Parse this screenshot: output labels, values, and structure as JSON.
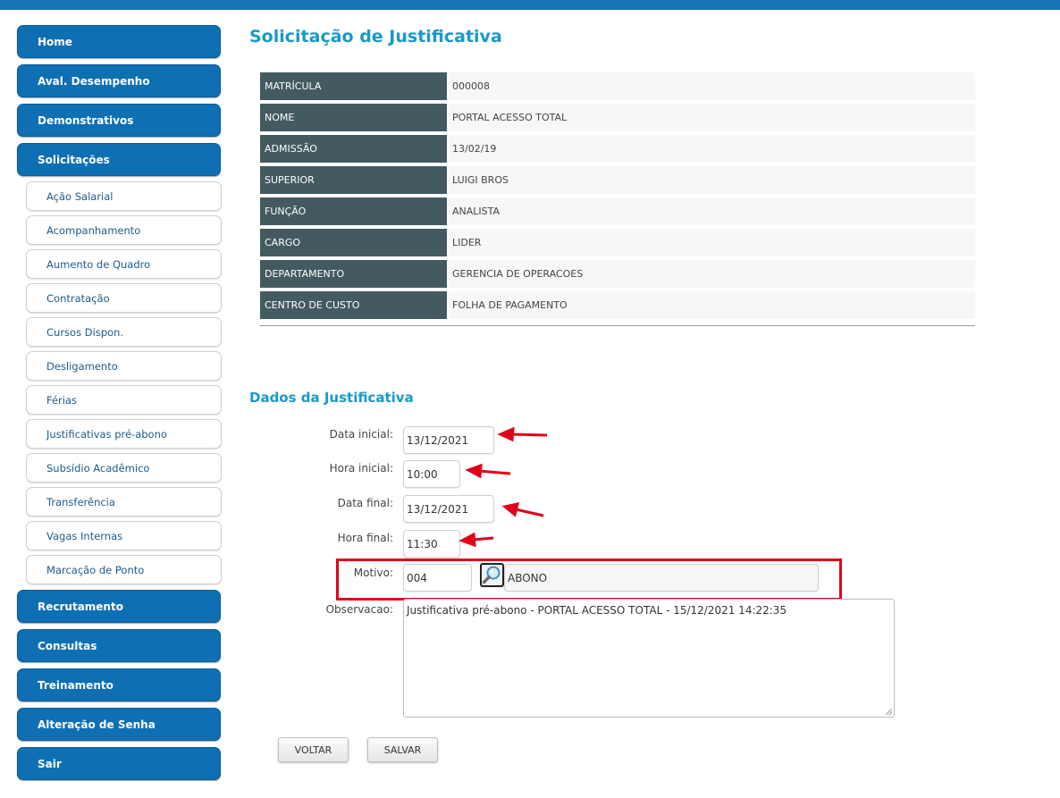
{
  "sidebar": {
    "items": [
      {
        "label": "Home"
      },
      {
        "label": "Aval. Desempenho"
      },
      {
        "label": "Demonstrativos"
      },
      {
        "label": "Solicitações"
      },
      {
        "label": "Recrutamento"
      },
      {
        "label": "Consultas"
      },
      {
        "label": "Treinamento"
      },
      {
        "label": "Alteração de Senha"
      },
      {
        "label": "Sair"
      }
    ],
    "subitems": [
      {
        "label": "Ação Salarial"
      },
      {
        "label": "Acompanhamento"
      },
      {
        "label": "Aumento de Quadro"
      },
      {
        "label": "Contratação"
      },
      {
        "label": "Cursos Dispon."
      },
      {
        "label": "Desligamento"
      },
      {
        "label": "Férias"
      },
      {
        "label": "Justificativas pré-abono"
      },
      {
        "label": "Subsídio Acadêmico"
      },
      {
        "label": "Transferência"
      },
      {
        "label": "Vagas Internas"
      },
      {
        "label": "Marcação de Ponto"
      }
    ]
  },
  "page": {
    "title": "Solicitação de Justificativa",
    "section_title": "Dados da Justificativa"
  },
  "employee": [
    {
      "label": "MATRÍCULA",
      "value": "000008"
    },
    {
      "label": "NOME",
      "value": "PORTAL ACESSO TOTAL"
    },
    {
      "label": "ADMISSÃO",
      "value": "13/02/19"
    },
    {
      "label": "SUPERIOR",
      "value": "LUIGI BROS"
    },
    {
      "label": "FUNÇÃO",
      "value": "ANALISTA"
    },
    {
      "label": "CARGO",
      "value": "LIDER"
    },
    {
      "label": "DEPARTAMENTO",
      "value": "GERENCIA DE OPERACOES"
    },
    {
      "label": "CENTRO DE CUSTO",
      "value": "FOLHA DE PAGAMENTO"
    }
  ],
  "form": {
    "data_inicial": {
      "label": "Data inicial:",
      "value": "13/12/2021"
    },
    "hora_inicial": {
      "label": "Hora inicial:",
      "value": "10:00"
    },
    "data_final": {
      "label": "Data final:",
      "value": "13/12/2021"
    },
    "hora_final": {
      "label": "Hora final:",
      "value": "11:30"
    },
    "motivo": {
      "label": "Motivo:",
      "code": "004",
      "description": "ABONO"
    },
    "observacao": {
      "label": "Observacao:",
      "value": "Justificativa pré-abono - PORTAL ACESSO TOTAL - 15/12/2021 14:22:35"
    }
  },
  "buttons": {
    "voltar": "VOLTAR",
    "salvar": "SALVAR"
  },
  "colors": {
    "accent": "#1a99c8",
    "nav": "#0f6fb3",
    "annotation": "#e0001a"
  },
  "icons": {
    "lookup": "magnifier-icon"
  }
}
